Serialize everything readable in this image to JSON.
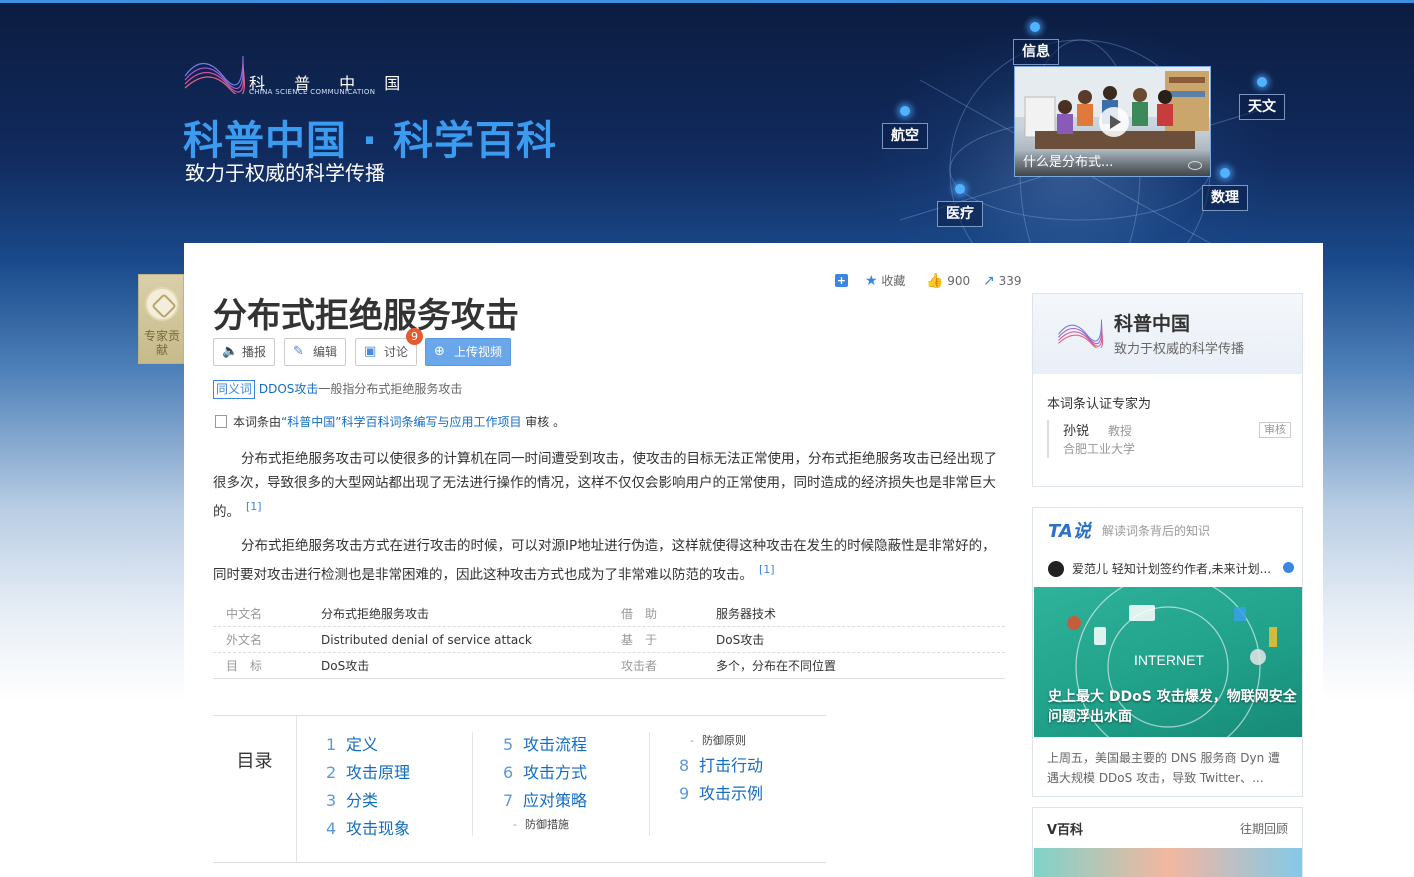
{
  "header": {
    "logo_cn": "科 普 中 国",
    "logo_en": "CHINA SCIENCE COMMUNICATION",
    "site_title": "科普中国 · 科学百科",
    "site_subtitle": "致力于权威的科学传播",
    "topics": [
      "信息",
      "天文",
      "航空",
      "数理",
      "医疗"
    ],
    "video_caption": "什么是分布式..."
  },
  "expert_badge": {
    "label": "专家贡献"
  },
  "actions": {
    "favorite": "收藏",
    "likes": "900",
    "shares": "339"
  },
  "entry": {
    "title": "分布式拒绝服务攻击",
    "buttons": {
      "broadcast": "播报",
      "edit": "编辑",
      "discuss": "讨论",
      "upload": "上传视频"
    },
    "discuss_count": "9",
    "synonym_tag": "同义词",
    "synonym_link": "DDOS攻击",
    "synonym_rest": "一般指分布式拒绝服务攻击",
    "review_prefix": "本词条由",
    "review_link": "“科普中国”科学百科词条编写与应用工作项目",
    "review_suffix": " 审核 。",
    "paragraphs": [
      "分布式拒绝服务攻击可以使很多的计算机在同一时间遭受到攻击，使攻击的目标无法正常使用，分布式拒绝服务攻击已经出现了很多次，导致很多的大型网站都出现了无法进行操作的情况，这样不仅仅会影响用户的正常使用，同时造成的经济损失也是非常巨大的。",
      "分布式拒绝服务攻击方式在进行攻击的时候，可以对源IP地址进行伪造，这样就使得这种攻击在发生的时候隐蔽性是非常好的，同时要对攻击进行检测也是非常困难的，因此这种攻击方式也成为了非常难以防范的攻击。"
    ],
    "citation": "[1]"
  },
  "info_table": [
    {
      "k1": "中文名",
      "v1": "分布式拒绝服务攻击",
      "k2": "借　助",
      "v2": "服务器技术"
    },
    {
      "k1": "外文名",
      "v1": "Distributed denial of service attack",
      "k2": "基　于",
      "v2": "DoS攻击"
    },
    {
      "k1": "目　标",
      "v1": "DoS攻击",
      "k2": "攻击者",
      "v2": "多个，分布在不同位置"
    }
  ],
  "toc": {
    "title": "目录",
    "items": [
      {
        "num": "1",
        "label": "定义"
      },
      {
        "num": "2",
        "label": "攻击原理"
      },
      {
        "num": "3",
        "label": "分类"
      },
      {
        "num": "4",
        "label": "攻击现象"
      },
      {
        "num": "5",
        "label": "攻击流程"
      },
      {
        "num": "6",
        "label": "攻击方式"
      },
      {
        "num": "7",
        "label": "应对策略"
      },
      {
        "num": "8",
        "label": "打击行动"
      },
      {
        "num": "9",
        "label": "攻击示例"
      }
    ],
    "subs": [
      "防御措施",
      "防御原则"
    ]
  },
  "sidebar": {
    "org_name": "科普中国",
    "org_slogan": "致力于权威的科学传播",
    "expert_label": "本词条认证专家为",
    "expert_name": "孙锐",
    "expert_title": "教授",
    "expert_org": "合肥工业大学",
    "expert_tag": "审核",
    "ta_logo": "TA说",
    "ta_sub": "解读词条背后的知识",
    "ta_author": "爱范儿  轻知计划签约作者,未来计划...",
    "ta_img_caption": "史上最大 DDoS 攻击爆发，物联网安全问题浮出水面",
    "ta_desc": "上周五，美国最主要的 DNS 服务商 Dyn 遭遇大规模 DDoS 攻击，导致 Twitter、...",
    "vb_title": "V百科",
    "vb_more": "往期回顾"
  }
}
